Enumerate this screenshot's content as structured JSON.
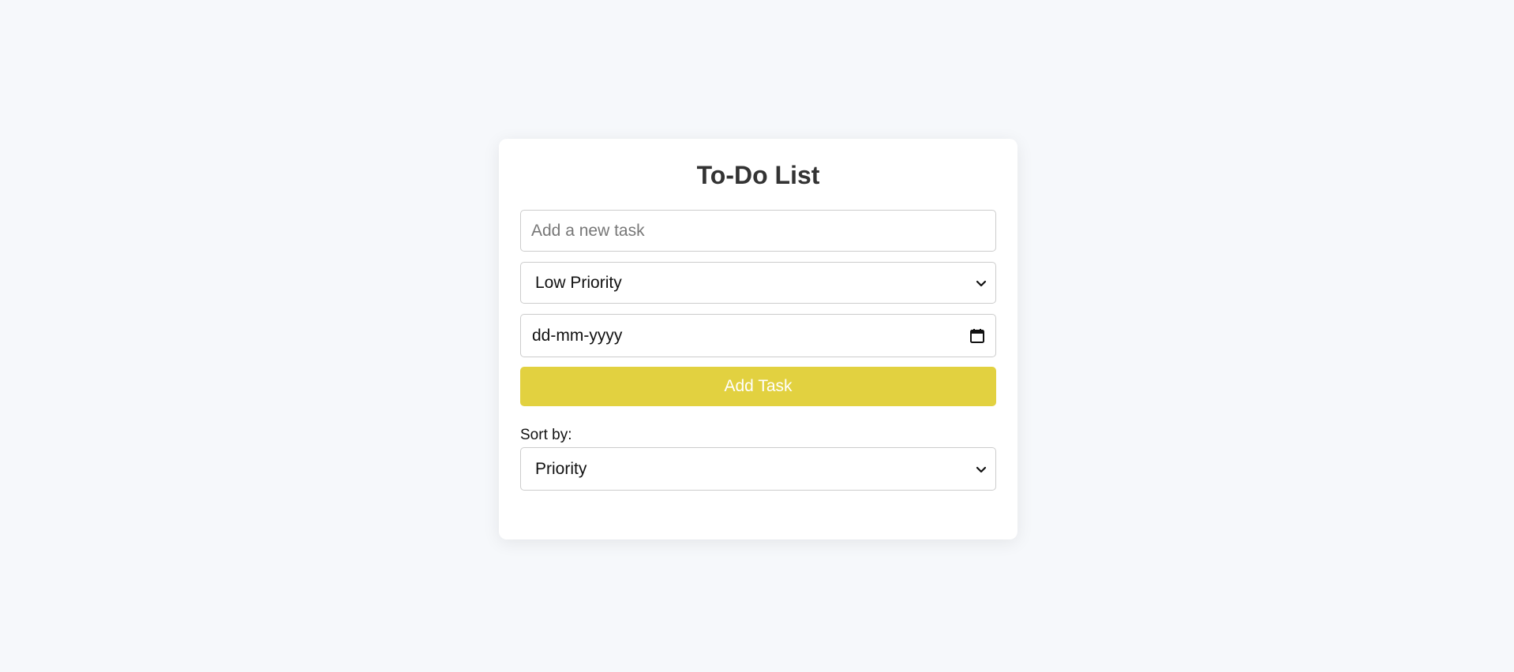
{
  "app": {
    "title": "To-Do List"
  },
  "form": {
    "task_input": {
      "placeholder": "Add a new task",
      "value": ""
    },
    "priority_select": {
      "selected": "Low Priority"
    },
    "date_input": {
      "value": "dd-mm-yyyy"
    },
    "add_button_label": "Add Task"
  },
  "sort": {
    "label": "Sort by:",
    "selected": "Priority"
  },
  "icons": {
    "dropdown": "chevron-down-icon",
    "calendar": "calendar-icon"
  },
  "colors": {
    "background": "#f6f8fb",
    "card": "#ffffff",
    "accent": "#e2d140",
    "title": "#333333",
    "border": "#cccccc"
  }
}
